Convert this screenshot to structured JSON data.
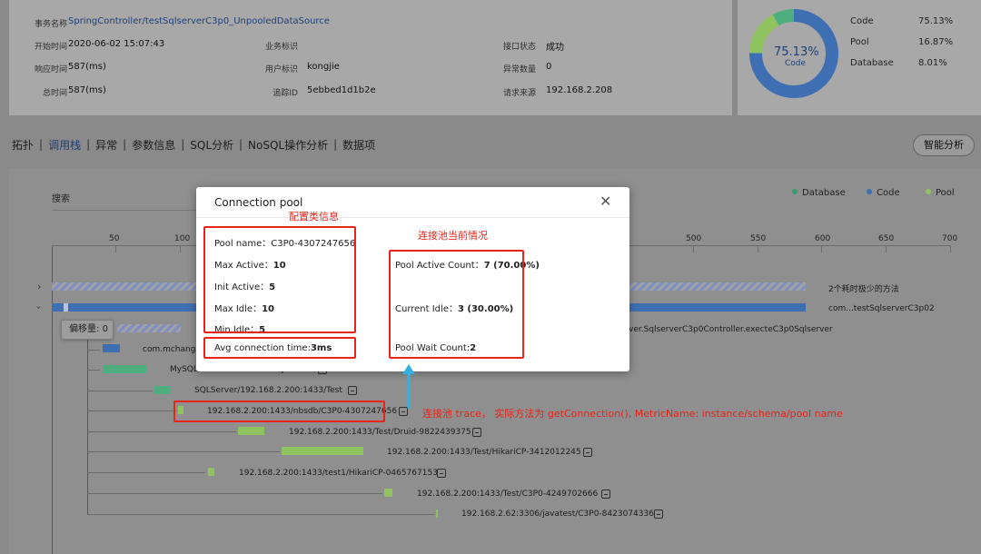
{
  "info": {
    "txn_label": "事务名称",
    "txn_value": "SpringController/testSqlserverC3p0_UnpooledDataSource",
    "start_label": "开始时间",
    "start_value": "2020-06-02 15:07:43",
    "biz_label": "业务标识",
    "biz_value": "",
    "if_status_label": "接口状态",
    "if_status_value": "成功",
    "resp_label": "响应时间",
    "resp_value": "587(ms)",
    "user_label": "用户标识",
    "user_value": "kongjie",
    "exc_label": "异常数量",
    "exc_value": "0",
    "total_label": "总时间",
    "total_value": "587(ms)",
    "trace_label": "追踪ID",
    "trace_value": "5ebbed1d1b2e",
    "source_label": "请求来源",
    "source_value": "192.168.2.208"
  },
  "pie": {
    "center_value": "75.13%",
    "center_label": "Code",
    "legend": [
      {
        "name": "Code",
        "value": "75.13%",
        "fraction": 0.7513,
        "color": "#3f6fb3"
      },
      {
        "name": "Pool",
        "value": "16.87%",
        "fraction": 0.1687,
        "color": "#8fc35f"
      },
      {
        "name": "Database",
        "value": "8.01%",
        "fraction": 0.0801,
        "color": "#4fae7f"
      }
    ]
  },
  "tabs": [
    {
      "label": "拓扑",
      "active": false
    },
    {
      "label": "调用栈",
      "active": true
    },
    {
      "label": "异常",
      "active": false
    },
    {
      "label": "参数信息",
      "active": false
    },
    {
      "label": "SQL分析",
      "active": false
    },
    {
      "label": "NoSQL操作分析",
      "active": false
    },
    {
      "label": "数据项",
      "active": false
    }
  ],
  "smart_button": "智能分析",
  "search_placeholder": "搜索",
  "main_legend": [
    {
      "name": "Database",
      "color": "#3f9a6e"
    },
    {
      "name": "Code",
      "color": "#3f6fb3"
    },
    {
      "name": "Pool",
      "color": "#8fc35f"
    }
  ],
  "axis_ticks": [
    "50",
    "100",
    "500",
    "550",
    "600",
    "650",
    "700"
  ],
  "trace": {
    "summary_label": "2个耗时极少的方法",
    "root_label": "com...testSqlserverC3p02",
    "controller_label": "ver.SqlserverC3p0Controller.execteC3p0Sqlserver",
    "offset_label": "偏移量:",
    "offset_value": "0",
    "rows": [
      {
        "label": "com.mchange.v"
      },
      {
        "label": "MySQL/192.168.2.62:3306/javatest"
      },
      {
        "label": "SQLServer/192.168.2.200:1433/Test"
      },
      {
        "label": "192.168.2.200:1433/nbsdb/C3P0-4307247656"
      },
      {
        "label": "192.168.2.200:1433/Test/Druid-9822439375"
      },
      {
        "label": "192.168.2.200:1433/Test/HikariCP-3412012245"
      },
      {
        "label": "192.168.2.200:1433/test1/HikariCP-0465767153"
      },
      {
        "label": "192.168.2.200:1433/Test/C3P0-4249702666"
      },
      {
        "label": "192.168.2.62:3306/javatest/C3P0-8423074336"
      }
    ]
  },
  "modal": {
    "title": "Connection pool",
    "config": [
      {
        "label": "Pool name：",
        "value": "C3P0-4307247656"
      },
      {
        "label": "Max Active：",
        "value": "10"
      },
      {
        "label": "Init Active：",
        "value": "5"
      },
      {
        "label": "Max Idle：",
        "value": "10"
      },
      {
        "label": "Min Idle：",
        "value": "5"
      }
    ],
    "avg_label": "Avg connection time:",
    "avg_value": "3ms",
    "status": [
      {
        "label": "Pool Active Count：",
        "value": "7 (70.00%)"
      },
      {
        "label": "Current Idle：",
        "value": "3 (30.00%)"
      },
      {
        "label": "Pool Wait Count:",
        "value": "2"
      }
    ]
  },
  "annotations": {
    "config_title": "配置类信息",
    "status_title": "连接池当前情况",
    "trace_note": "连接池 trace， 实际方法为 getConnection(), MetricName: instance/schema/pool name"
  }
}
